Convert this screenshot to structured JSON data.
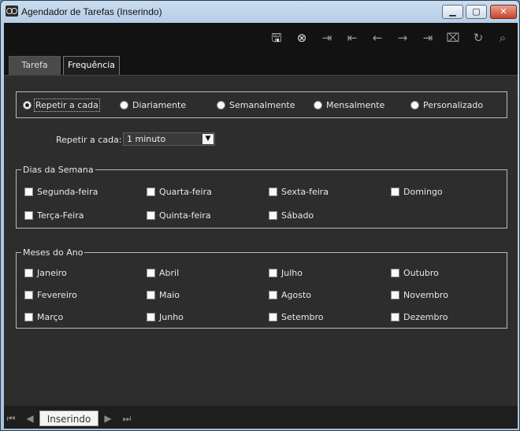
{
  "window": {
    "title": "Agendador de Tarefas (Inserindo)",
    "min_icon": "minimize-icon",
    "max_icon": "maximize-icon",
    "close_icon": "close-icon"
  },
  "toolbar": {
    "icons": [
      "save-icon",
      "cancel-icon",
      "insert-icon",
      "first-record-icon",
      "previous-record-icon",
      "next-record-icon",
      "last-record-icon",
      "delete-icon",
      "refresh-icon",
      "search-icon"
    ]
  },
  "tabs": [
    {
      "label": "Tarefa",
      "active": false
    },
    {
      "label": "Frequência",
      "active": true
    }
  ],
  "frequency": {
    "options": [
      {
        "label": "Repetir a cada",
        "checked": true
      },
      {
        "label": "Diariamente",
        "checked": false
      },
      {
        "label": "Semanalmente",
        "checked": false
      },
      {
        "label": "Mensalmente",
        "checked": false
      },
      {
        "label": "Personalizado",
        "checked": false
      }
    ]
  },
  "repeat": {
    "label": "Repetir a cada:",
    "value": "1 minuto"
  },
  "days": {
    "title": "Dias da Semana",
    "items": [
      "Segunda-feira",
      "Terça-Feira",
      "Quarta-feira",
      "Quinta-feira",
      "Sexta-feira",
      "Sábado",
      "Domingo"
    ]
  },
  "months": {
    "title": "Meses do Ano",
    "items": [
      "Janeiro",
      "Fevereiro",
      "Março",
      "Abril",
      "Maio",
      "Junho",
      "Julho",
      "Agosto",
      "Setembro",
      "Outubro",
      "Novembro",
      "Dezembro"
    ]
  },
  "status": {
    "mode": "Inserindo"
  },
  "colors": {
    "background": "#2d2d2d",
    "toolbar": "#121212",
    "accent": "#e8e8e8"
  }
}
